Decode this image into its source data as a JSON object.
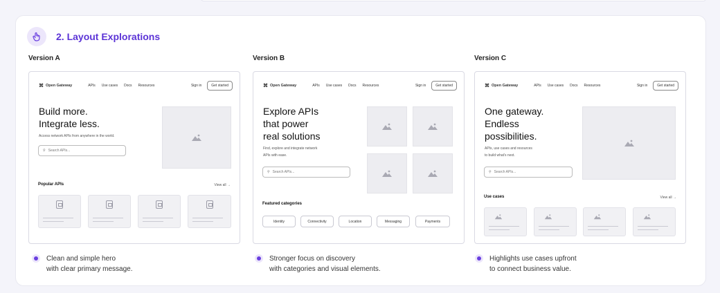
{
  "section": {
    "title": "2. Layout Explorations",
    "icon": "pointer-hand-icon"
  },
  "mock_nav": {
    "brand": "Open Gateway",
    "links": [
      "APIs",
      "Use cases",
      "Docs",
      "Resources"
    ],
    "signin": "Sign in",
    "cta": "Get started",
    "search_placeholder": "Search APIs..."
  },
  "versions": [
    {
      "label": "Version A",
      "headline": [
        "Build more.",
        "Integrate less."
      ],
      "subtext": [
        "Access network APIs from anywhere in the world."
      ],
      "section_label": "Popular APIs",
      "view_all": "View all →",
      "bullet": [
        "Clean and simple hero",
        "with clear primary message."
      ]
    },
    {
      "label": "Version B",
      "headline": [
        "Explore APIs",
        "that power",
        "real solutions"
      ],
      "subtext": [
        "Find, explore and integrate network",
        "APIs with ease."
      ],
      "section_label": "Featured categories",
      "categories": [
        "Identity",
        "Connectivity",
        "Location",
        "Messaging",
        "Payments"
      ],
      "bullet": [
        "Stronger focus on discovery",
        "with categories and visual elements."
      ]
    },
    {
      "label": "Version C",
      "headline": [
        "One gateway.",
        "Endless",
        "possibilities."
      ],
      "subtext": [
        "APIs, use cases and resources",
        "to build what's next."
      ],
      "section_label": "Use cases",
      "view_all": "View all →",
      "bullet": [
        "Highlights use cases upfront",
        "to connect business value."
      ]
    }
  ],
  "colors": {
    "accent": "#5b33d6",
    "accent_soft": "#ece6fb",
    "placeholder": "#ededf1"
  }
}
